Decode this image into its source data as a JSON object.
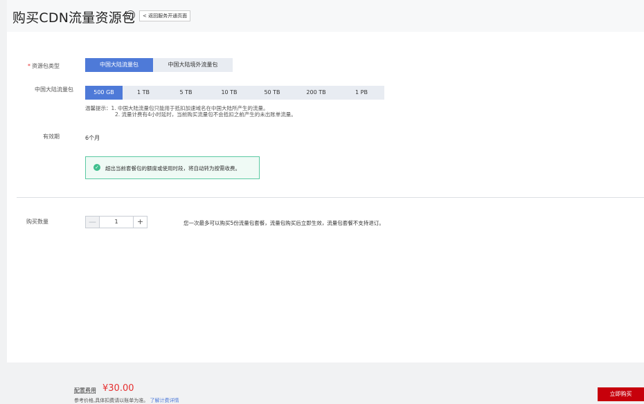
{
  "header": {
    "title": "购买CDN流量资源包",
    "help_glyph": "?",
    "back_label": "< 返回服务开通页面"
  },
  "form": {
    "package_type": {
      "label": "资源包类型",
      "required_mark": "*",
      "options": [
        "中国大陆流量包",
        "中国大陆境外流量包"
      ],
      "selected": "中国大陆流量包"
    },
    "traffic": {
      "label": "中国大陆流量包",
      "options": [
        "500 GB",
        "1 TB",
        "5 TB",
        "10 TB",
        "50 TB",
        "200 TB",
        "1 PB"
      ],
      "selected": "500 GB"
    },
    "tips": {
      "line1": "温馨提示：1. 中国大陆流量包只能用于抵扣加速域名在中国大陆所产生的流量。",
      "line2": "2. 流量计费有4小时延时，当前购买流量包不会抵扣之前产生的未出账单流量。"
    },
    "validity": {
      "label": "有效期",
      "value": "6个月"
    },
    "notice": {
      "icon": "check-circle-icon",
      "text": "超出当前套餐包的额度或使用时段，将自动转为按需收费。"
    },
    "quantity": {
      "label": "购买数量",
      "value": "1",
      "minus": "—",
      "plus": "+",
      "hint": "您一次最多可以购买5份流量包套餐，流量包购买后立即生效，流量包套餐不支持退订。"
    }
  },
  "footer": {
    "fee_label": "配置费用",
    "price": "¥30.00",
    "note": "参考价格,具体扣费请以账单为准。",
    "note_link": "了解计费详情",
    "buy_label": "立即购买"
  },
  "colors": {
    "accent": "#4e7ad8",
    "price": "#e62e2e",
    "buy": "#c7000b",
    "success": "#3fbf8e"
  }
}
